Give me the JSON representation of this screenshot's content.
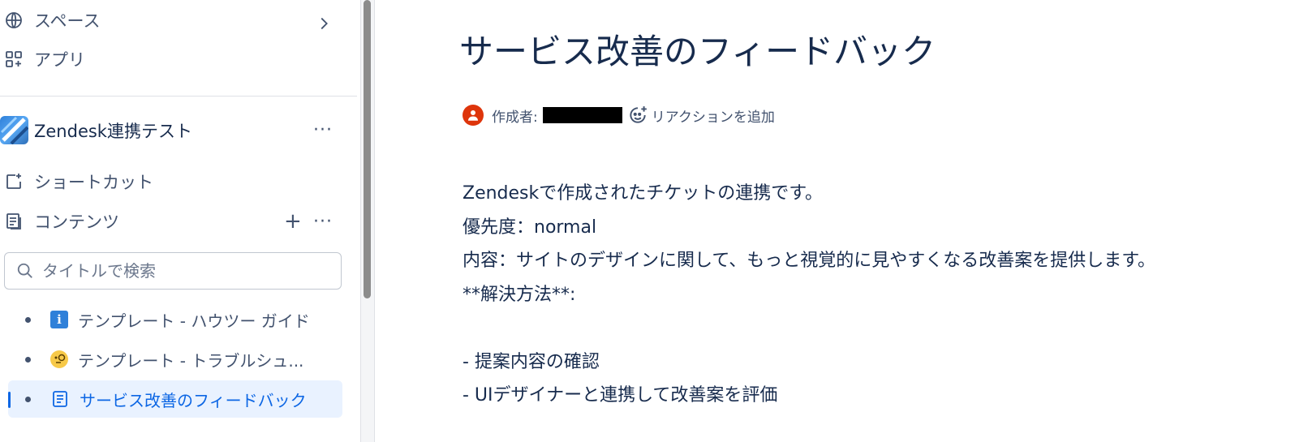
{
  "sidebar": {
    "nav": [
      {
        "label": "スペース",
        "icon": "globe-icon"
      },
      {
        "label": "アプリ",
        "icon": "apps-icon"
      }
    ],
    "space_name": "Zendesk連携テスト",
    "shortcuts_label": "ショートカット",
    "contents_label": "コンテンツ",
    "search_placeholder": "タイトルで検索",
    "tree": [
      {
        "label": "テンプレート - ハウツー ガイド",
        "icon": "info-icon"
      },
      {
        "label": "テンプレート - トラブルシュ...",
        "icon": "magnifier-face-icon"
      },
      {
        "label": "サービス改善のフィードバック",
        "icon": "page-icon",
        "active": true
      }
    ]
  },
  "page": {
    "title": "サービス改善のフィードバック",
    "author_label": "作成者:",
    "add_reaction": "リアクションを追加",
    "body": [
      "Zendeskで作成されたチケットの連携です。",
      "優先度：normal",
      "内容：サイトのデザインに関して、もっと視覚的に見やすくなる改善案を提供します。",
      "**解決方法**:",
      "",
      "- 提案内容の確認",
      "- UIデザイナーと連携して改善案を評価"
    ]
  },
  "colors": {
    "accent": "#0c66e4",
    "active_bg": "#e9f2ff",
    "avatar": "#de350b"
  }
}
